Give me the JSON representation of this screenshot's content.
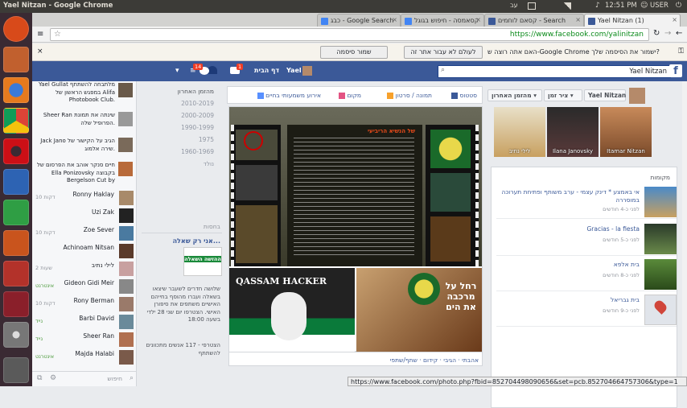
{
  "os_bar": {
    "window_title": "Yael Nitzan - Google Chrome",
    "time": "12:51 PM",
    "user": "USER",
    "lang": "עב"
  },
  "launcher": {
    "items": [
      "ubuntu-icon",
      "files-icon",
      "firefox-icon",
      "chrome-icon",
      "opera-icon",
      "writer-icon",
      "calc-icon",
      "impress-icon",
      "settings-icon",
      "workspace-icon",
      "dvd-icon",
      "trash-icon"
    ]
  },
  "tabs": [
    {
      "label": "Yael Nitzan (1)"
    },
    {
      "label": "קסאם לוחמים - Search"
    },
    {
      "label": "קסאמסה - חיפוש בגוגל"
    },
    {
      "label": "כבג - Google Search"
    }
  ],
  "omnibox": {
    "url": "https://www.facebook.com/yalinitzan"
  },
  "infobar": {
    "message": "האם אתה רוצה ש-Google Chrome ישמור את הסיסמה שלך?",
    "save_label": "שמור סיסמה",
    "never_label": "לעולם לא עבור אתר זה"
  },
  "fb_header": {
    "search_value": "Yael Nitzan",
    "logo": "f",
    "home": "דף הבית",
    "profile": "Yael",
    "badge_1": "1",
    "badge_2": "14"
  },
  "chat": {
    "feed": [
      {
        "text": "Yael Gullat מלתבחה להשתתף במפגש הראשון של Alifa Photobook Club."
      },
      {
        "text": "Sheer Ran שינתה את תמונת הפרופיל שלה."
      },
      {
        "text": "Jack Jano הגיב על הקישור של שירה אלמוג."
      },
      {
        "text": "חיים סנקר אוהב את הפרסום של Ella Ponizovsky בקבוצה Bergelson Cut by"
      }
    ],
    "people": [
      {
        "name": "Ronny Haklay",
        "status": "10 דקות"
      },
      {
        "name": "Uzi Zak",
        "status": ""
      },
      {
        "name": "Zoe Sever",
        "status": "10 דקות"
      },
      {
        "name": "Achinoam Nitsan",
        "status": ""
      },
      {
        "name": "לילי נתיב",
        "status": "2 שעות"
      },
      {
        "name": "Gideon Gidi Meir",
        "status": "אינטרנט"
      },
      {
        "name": "Rony Berman",
        "status": "10 דקות"
      },
      {
        "name": "Barbi David",
        "status": "נייד"
      },
      {
        "name": "Sheer Ran",
        "status": "נייד"
      },
      {
        "name": "Majda Halabi",
        "status": "אינטרנט"
      }
    ],
    "search_placeholder": "חיפוש"
  },
  "timeline": {
    "years": [
      "מהזמן האחרון",
      "2010-2019",
      "2000-2009",
      "1990-1999",
      "1975",
      "1960-1969",
      "נולד"
    ],
    "ad_title": "בחסות",
    "ad_heading": "אני רק שאלה...",
    "ad_img_text": "ההזשה השאלה",
    "ad_body": "שלושה חדרים לשעבר שיצאו בשאלה ועברו מהוסף בחייהם האישיים משתפים את סיפורן האישי. הצטרפו יום שני 28 ילדי בשעה 18:00",
    "ad_footer": "הצטרפי - 117 אנשים מתכוונים להשתתף"
  },
  "composer": {
    "status": "סטטוס",
    "photo": "תמונה / סרטון",
    "place": "מקום",
    "event": "אירוע משמעותי בחיים"
  },
  "photos": {
    "headline_1": "של הנשיא הריביעי",
    "img2_text": "QASSAM HACKER",
    "img3_text": "רחל על מרכבה את הים",
    "action_text": "אהבתי · הגיבי · קידום · שתף/שתפי"
  },
  "right": {
    "name_btn": "Yael Nitzan",
    "sort_1": "ציר זמן",
    "sort_2": "מהזמן האחרון",
    "friends": [
      {
        "name": "Itamar Nitzan"
      },
      {
        "name": "Ilana Janovsky"
      },
      {
        "name": "לילי נתיב"
      }
    ],
    "places_header": "מקומות",
    "places": [
      {
        "title": "אי באמצע * דינק עצמי - ערב משותף ופתיחת תערוכה במוסררה",
        "sub": "לפני כ-4 חודשים"
      },
      {
        "title": "Gracias - la fiesta",
        "sub": "לפני כ-5 חודשים"
      },
      {
        "title": "בית אלפא",
        "sub": "לפני כ-8 חודשים"
      },
      {
        "title": "בית גבריאל",
        "sub": "לפני כ-9 חודשים"
      }
    ]
  },
  "status_url": "https://www.facebook.com/photo.php?fbid=852704498090656&set=pcb.852704664757306&type=1"
}
